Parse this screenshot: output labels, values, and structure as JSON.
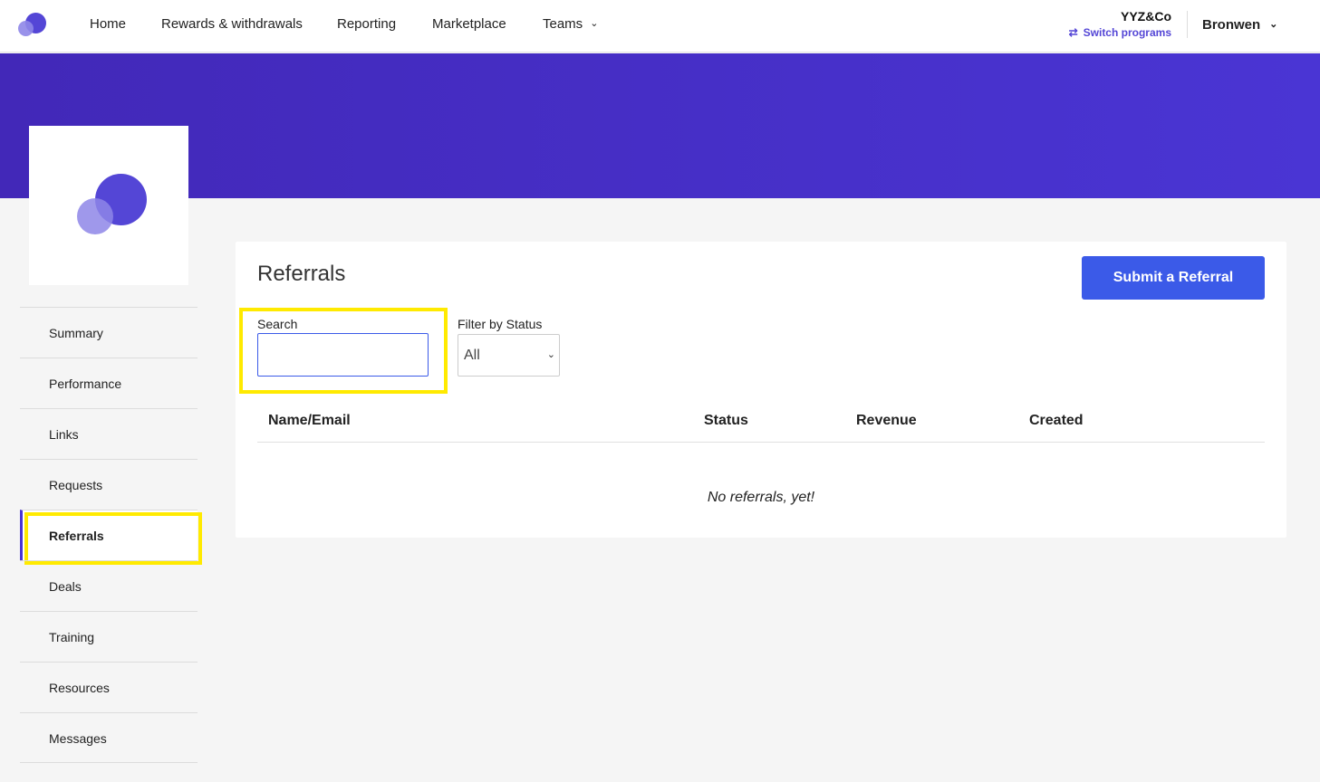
{
  "nav": {
    "items": [
      "Home",
      "Rewards & withdrawals",
      "Reporting",
      "Marketplace",
      "Teams"
    ],
    "org_name": "YYZ&Co",
    "switch_label": "Switch programs",
    "user_name": "Bronwen"
  },
  "sidebar": {
    "items": [
      "Summary",
      "Performance",
      "Links",
      "Requests",
      "Referrals",
      "Deals",
      "Training",
      "Resources",
      "Messages"
    ],
    "active": "Referrals"
  },
  "main": {
    "title": "Referrals",
    "submit_label": "Submit a Referral",
    "search_label": "Search",
    "search_value": "",
    "filter_label": "Filter by Status",
    "filter_value": "All",
    "columns": [
      "Name/Email",
      "Status",
      "Revenue",
      "Created"
    ],
    "empty_message": "No referrals, yet!"
  },
  "colors": {
    "brand": "#4a35d4",
    "button": "#3b5ae8",
    "highlight": "#ffea00"
  },
  "icons": [
    "logo-icon",
    "chevron-down-icon",
    "shuffle-icon"
  ]
}
